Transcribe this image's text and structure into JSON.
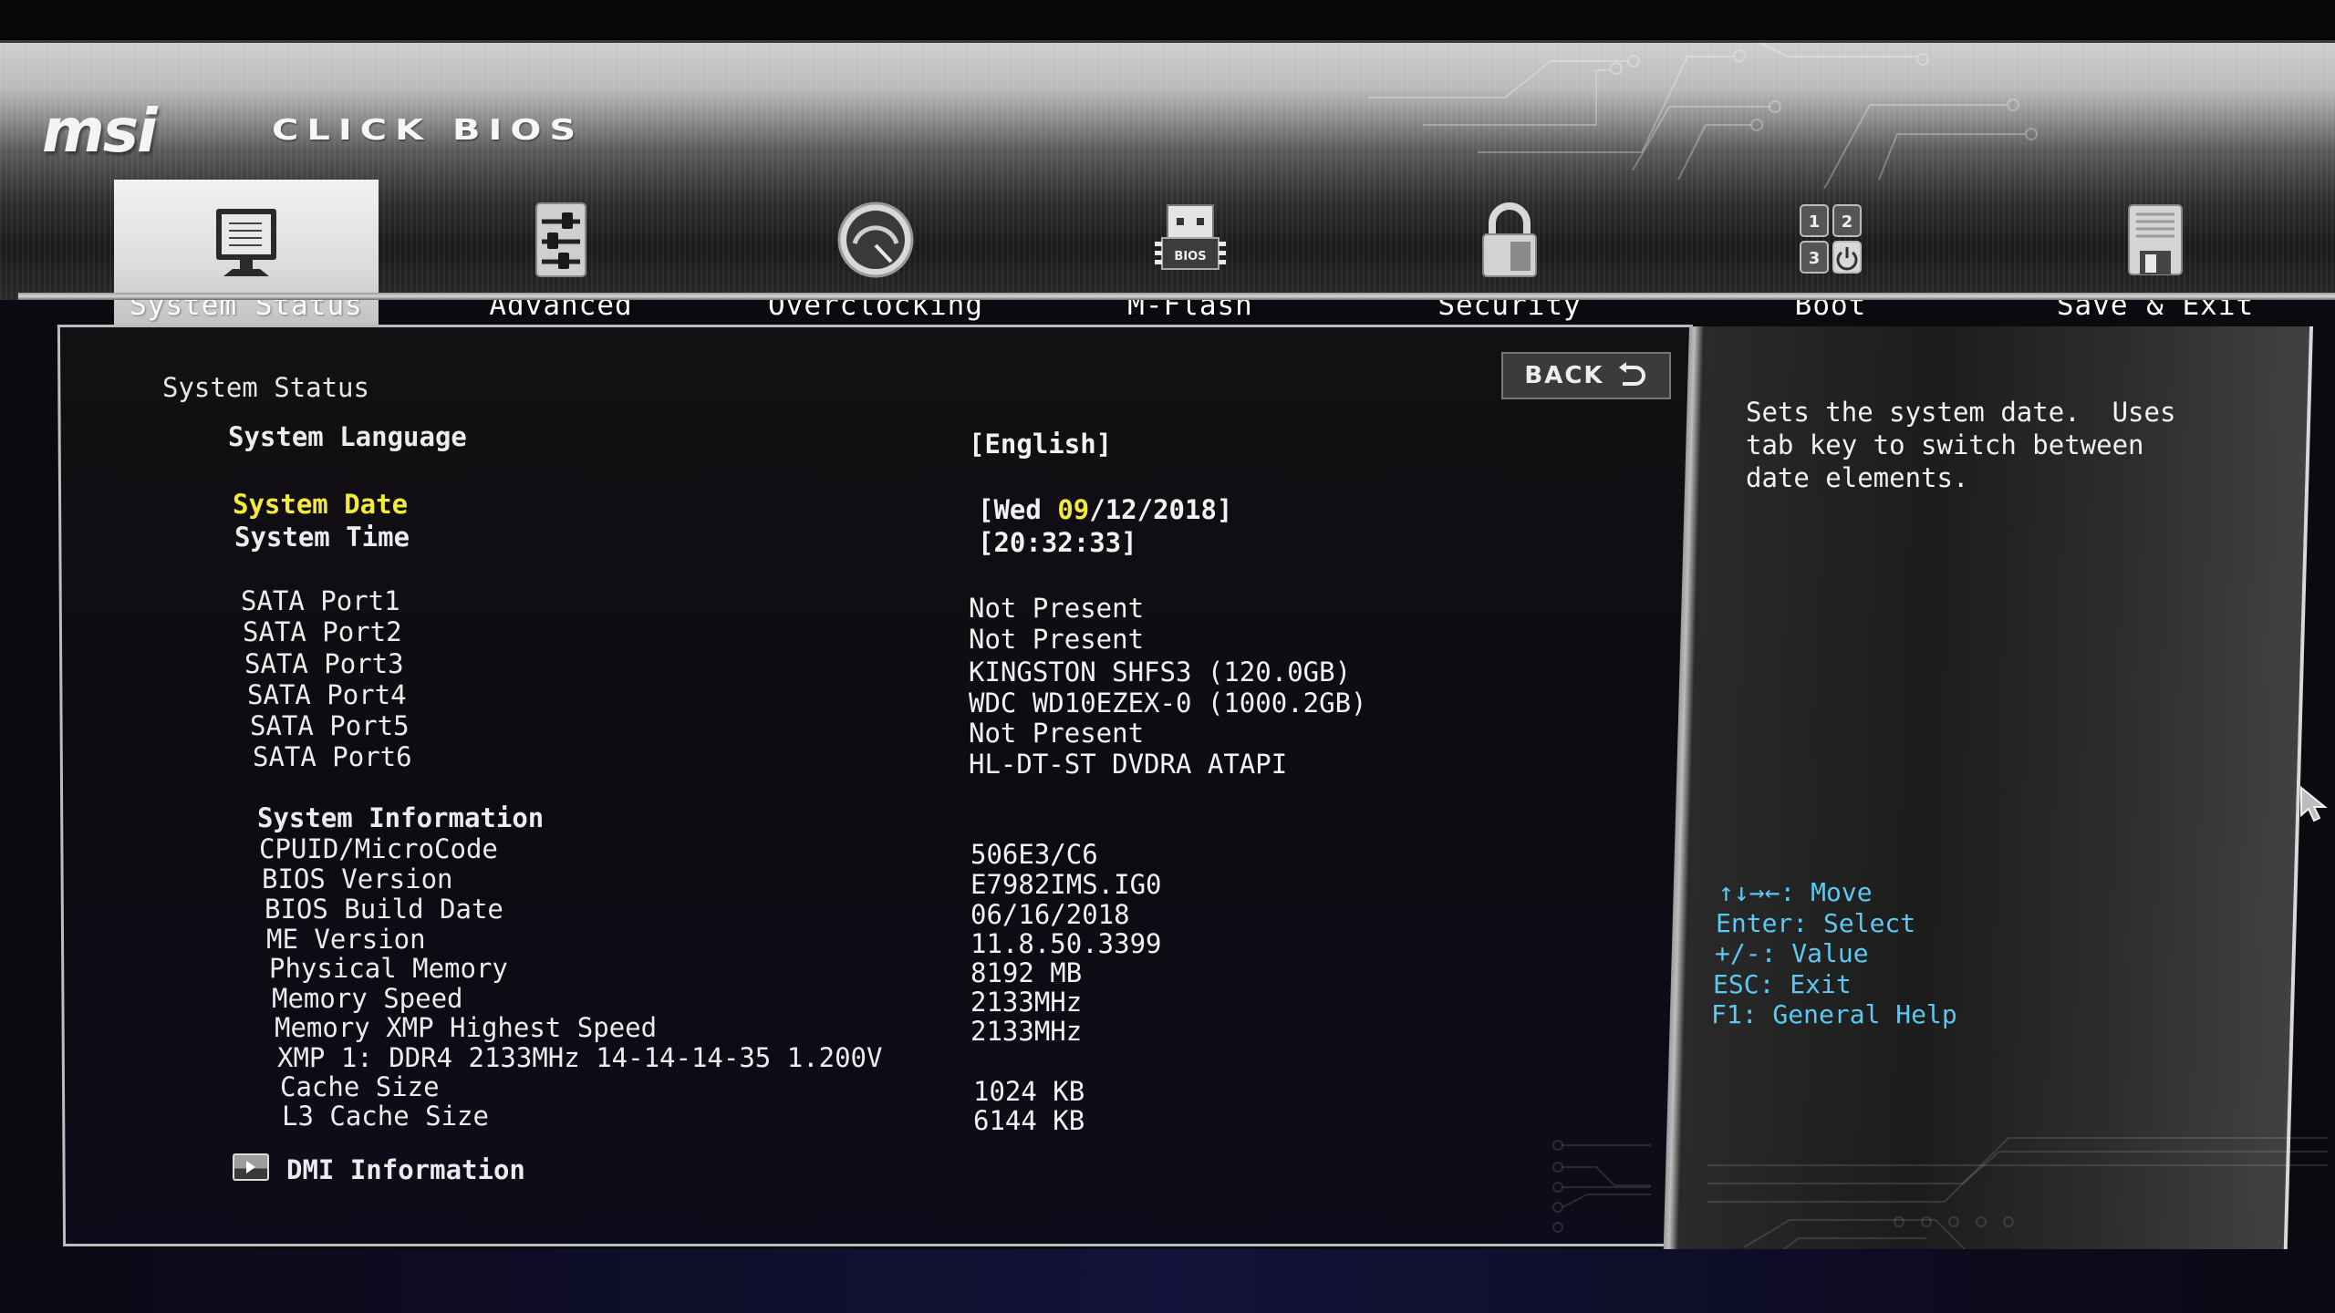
{
  "app": {
    "brand": "msi",
    "product": "CLICK BIOS"
  },
  "nav": {
    "tabs": [
      {
        "label": "System Status",
        "icon": "monitor-icon",
        "active": true
      },
      {
        "label": "Advanced",
        "icon": "sliders-icon",
        "active": false
      },
      {
        "label": "Overclocking",
        "icon": "gauge-icon",
        "active": false
      },
      {
        "label": "M-Flash",
        "icon": "usb-bios-chip-icon",
        "active": false
      },
      {
        "label": "Security",
        "icon": "padlock-icon",
        "active": false
      },
      {
        "label": "Boot",
        "icon": "boot-order-icon",
        "active": false
      },
      {
        "label": "Save & Exit",
        "icon": "floppy-disk-icon",
        "active": false
      }
    ]
  },
  "main": {
    "section_title": "System Status",
    "back_label": "BACK",
    "language": {
      "label": "System Language",
      "value": "[English]"
    },
    "date": {
      "label": "System Date",
      "value_prefix": "[Wed ",
      "value_highlight": "09",
      "value_suffix": "/12/2018]"
    },
    "time": {
      "label": "System Time",
      "value": "[20:32:33]"
    },
    "sata": [
      {
        "label": "SATA Port1",
        "value": "Not Present"
      },
      {
        "label": "SATA Port2",
        "value": "Not Present"
      },
      {
        "label": "SATA Port3",
        "value": "KINGSTON SHFS3 (120.0GB)"
      },
      {
        "label": "SATA Port4",
        "value": "WDC WD10EZEX-0 (1000.2GB)"
      },
      {
        "label": "SATA Port5",
        "value": "Not Present"
      },
      {
        "label": "SATA Port6",
        "value": "HL-DT-ST DVDRA ATAPI"
      }
    ],
    "sysinfo_title": "System Information",
    "sysinfo": [
      {
        "label": "CPUID/MicroCode",
        "value": "506E3/C6"
      },
      {
        "label": "BIOS Version",
        "value": "E7982IMS.IG0"
      },
      {
        "label": "BIOS Build Date",
        "value": "06/16/2018"
      },
      {
        "label": "ME Version",
        "value": "11.8.50.3399"
      },
      {
        "label": "Physical Memory",
        "value": "8192 MB"
      },
      {
        "label": "Memory Speed",
        "value": "2133MHz"
      },
      {
        "label": "Memory XMP Highest Speed",
        "value": "2133MHz"
      },
      {
        "label": "XMP 1: DDR4 2133MHz 14-14-14-35 1.200V",
        "value": ""
      },
      {
        "label": "Cache Size",
        "value": "1024 KB"
      },
      {
        "label": "L3 Cache Size",
        "value": "6144 KB"
      }
    ],
    "dmi_label": "DMI Information"
  },
  "help": {
    "text": "Sets the system date.  Uses\ntab key to switch between\ndate elements.",
    "keys": [
      "↑↓→←: Move",
      "Enter: Select",
      "+/-: Value",
      "ESC: Exit",
      "F1: General Help"
    ]
  },
  "colors": {
    "highlight": "#f4ea3a",
    "key_help": "#5cc9f2"
  }
}
